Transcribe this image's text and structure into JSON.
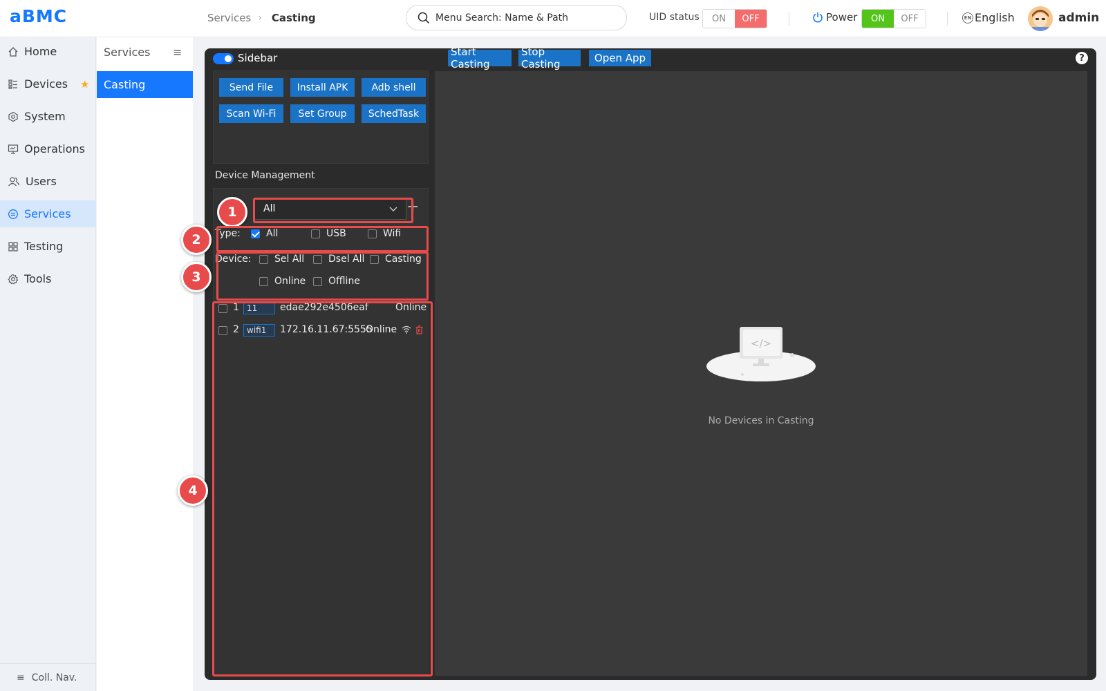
{
  "header": {
    "logo": "aBMC",
    "breadcrumb": [
      "Services",
      "Casting"
    ],
    "search_placeholder": "Menu Search: Name & Path",
    "uid_label": "UID status",
    "uid_on": "ON",
    "uid_off": "OFF",
    "power_label": "Power",
    "power_on": "ON",
    "power_off": "OFF",
    "language": "English",
    "user": "admin"
  },
  "nav": {
    "items": [
      {
        "label": "Home",
        "icon": "home-icon"
      },
      {
        "label": "Devices",
        "icon": "devices-icon"
      },
      {
        "label": "System",
        "icon": "system-icon"
      },
      {
        "label": "Operations",
        "icon": "operations-icon"
      },
      {
        "label": "Users",
        "icon": "users-icon"
      },
      {
        "label": "Services",
        "icon": "services-icon"
      },
      {
        "label": "Testing",
        "icon": "testing-icon"
      },
      {
        "label": "Tools",
        "icon": "tools-icon"
      }
    ],
    "active": "Services",
    "collapse_label": "Coll. Nav."
  },
  "subnav": {
    "title": "Services",
    "items": [
      "Casting"
    ]
  },
  "panel": {
    "sidebar_label": "Sidebar",
    "top_buttons": [
      "Start Casting",
      "Stop Casting",
      "Open App"
    ],
    "action_buttons": [
      "Send File",
      "Install APK",
      "Adb shell",
      "Scan Wi-Fi",
      "Set Group",
      "SchedTask"
    ],
    "device_mgmt_title": "Device Management",
    "group_select_value": "All",
    "type_label": "Type:",
    "type_options": [
      {
        "label": "All",
        "checked": true
      },
      {
        "label": "USB",
        "checked": false
      },
      {
        "label": "Wifi",
        "checked": false
      }
    ],
    "device_label": "Device:",
    "device_options": [
      {
        "label": "Sel All",
        "checked": false
      },
      {
        "label": "Dsel All",
        "checked": false
      },
      {
        "label": "Casting",
        "checked": false
      },
      {
        "label": "Online",
        "checked": false
      },
      {
        "label": "Offline",
        "checked": false
      }
    ],
    "devices": [
      {
        "num": "1",
        "tag": "11",
        "id": "edae292e4506eaf",
        "status": "Online"
      },
      {
        "num": "2",
        "tag": "wifi1",
        "id": "172.16.11.67:5555",
        "status": "Online"
      }
    ],
    "empty_text": "No Devices in Casting"
  },
  "annotations": [
    "1",
    "2",
    "3",
    "4"
  ],
  "colors": {
    "primary": "#1677ff",
    "button_blue": "#1a73c7",
    "annotation_red": "#e84b4b",
    "off_red": "#f56c6c",
    "on_green": "#52c41a",
    "panel_dark": "#2b2b2b"
  }
}
